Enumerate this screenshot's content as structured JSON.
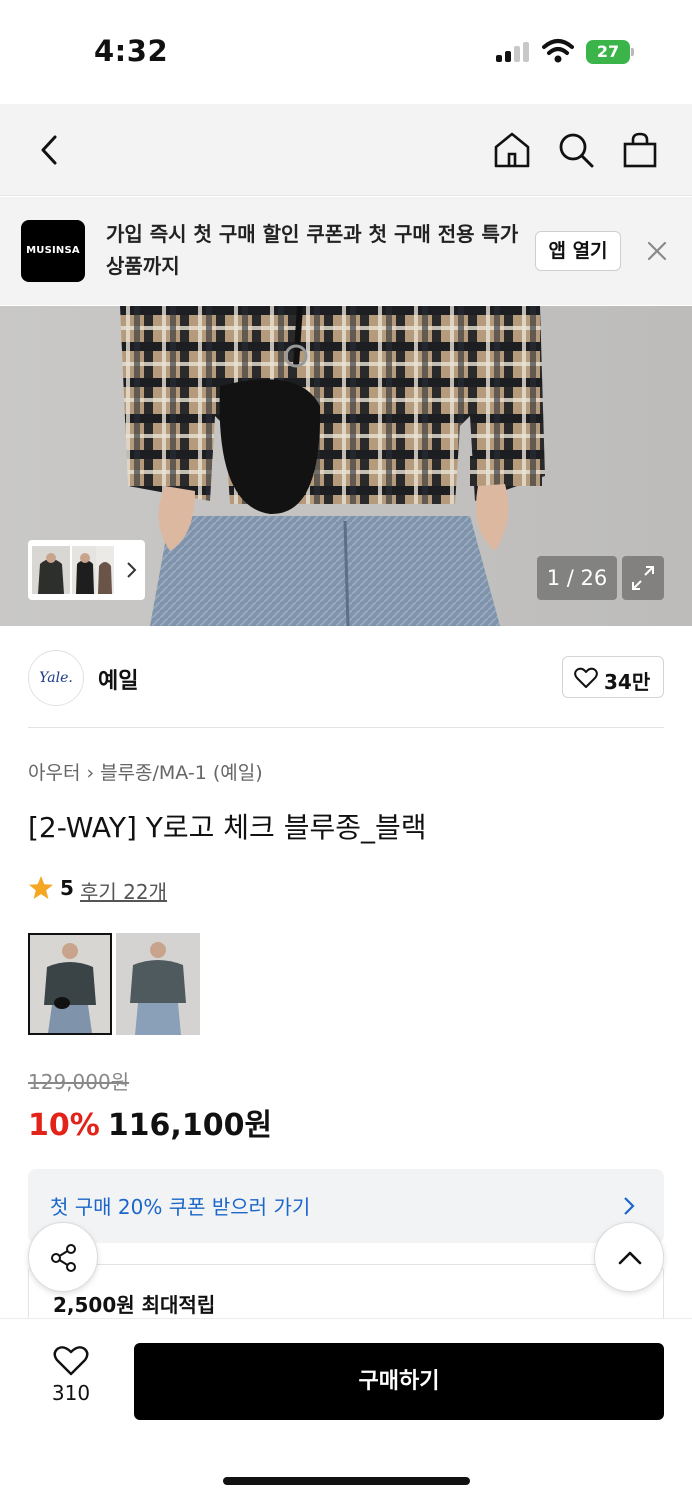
{
  "status_bar": {
    "time": "4:32",
    "battery": "27"
  },
  "nav": {
    "back_icon": "chevron-left-icon",
    "home_icon": "home-icon",
    "search_icon": "search-icon",
    "cart_icon": "bag-icon"
  },
  "promo": {
    "logo_text": "MUSINSA",
    "message": "가입 즉시 첫 구매 할인 쿠폰과 첫 구매 전용 특가 상품까지",
    "open_app_label": "앱 열기"
  },
  "gallery": {
    "counter": "1 / 26"
  },
  "brand": {
    "logo_text": "Yale.",
    "name": "예일",
    "like_count": "34만"
  },
  "product": {
    "breadcrumb": [
      "아우터",
      "블루종/MA-1 (예일)"
    ],
    "title": "[2-WAY] Y로고 체크 블루종_블랙",
    "rating": "5",
    "reviews": "후기 22개",
    "original_price": "129,000원",
    "discount": "10%",
    "price": "116,100원"
  },
  "coupon": {
    "text": "첫 구매 20% 쿠폰 받으러 가기"
  },
  "points": {
    "text": "2,500원 최대적립"
  },
  "bottom": {
    "wish_count": "310",
    "buy_label": "구매하기"
  },
  "colors": {
    "accent_red": "#e2231a",
    "link_blue": "#1b66c9",
    "star": "#f5a623"
  }
}
